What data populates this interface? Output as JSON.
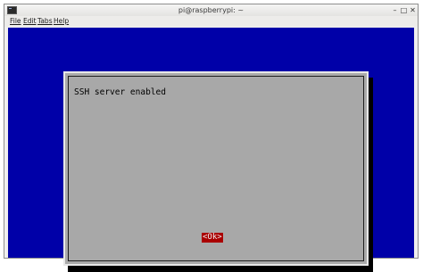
{
  "window": {
    "title": "pi@raspberrypi: ~",
    "minimize_glyph": "–",
    "maximize_glyph": "□",
    "close_glyph": "✕"
  },
  "menubar": {
    "items": [
      "File",
      "Edit",
      "Tabs",
      "Help"
    ]
  },
  "dialog": {
    "message": "SSH server enabled",
    "ok_label": "<Ok>"
  },
  "colors": {
    "terminal_bg": "#0000a8",
    "dialog_bg": "#aaaaaa",
    "button_bg": "#aa0000"
  },
  "icons": {
    "app": "terminal-icon"
  }
}
